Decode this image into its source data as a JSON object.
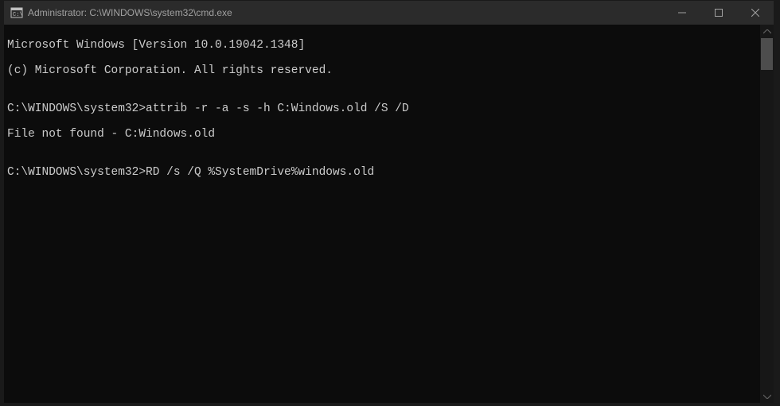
{
  "titlebar": {
    "title": "Administrator: C:\\WINDOWS\\system32\\cmd.exe"
  },
  "terminal": {
    "line1": "Microsoft Windows [Version 10.0.19042.1348]",
    "line2": "(c) Microsoft Corporation. All rights reserved.",
    "line3": "",
    "line4": "C:\\WINDOWS\\system32>attrib -r -a -s -h C:Windows.old /S /D",
    "line5": "File not found - C:Windows.old",
    "line6": "",
    "line7": "C:\\WINDOWS\\system32>RD /s /Q %SystemDrive%windows.old"
  }
}
